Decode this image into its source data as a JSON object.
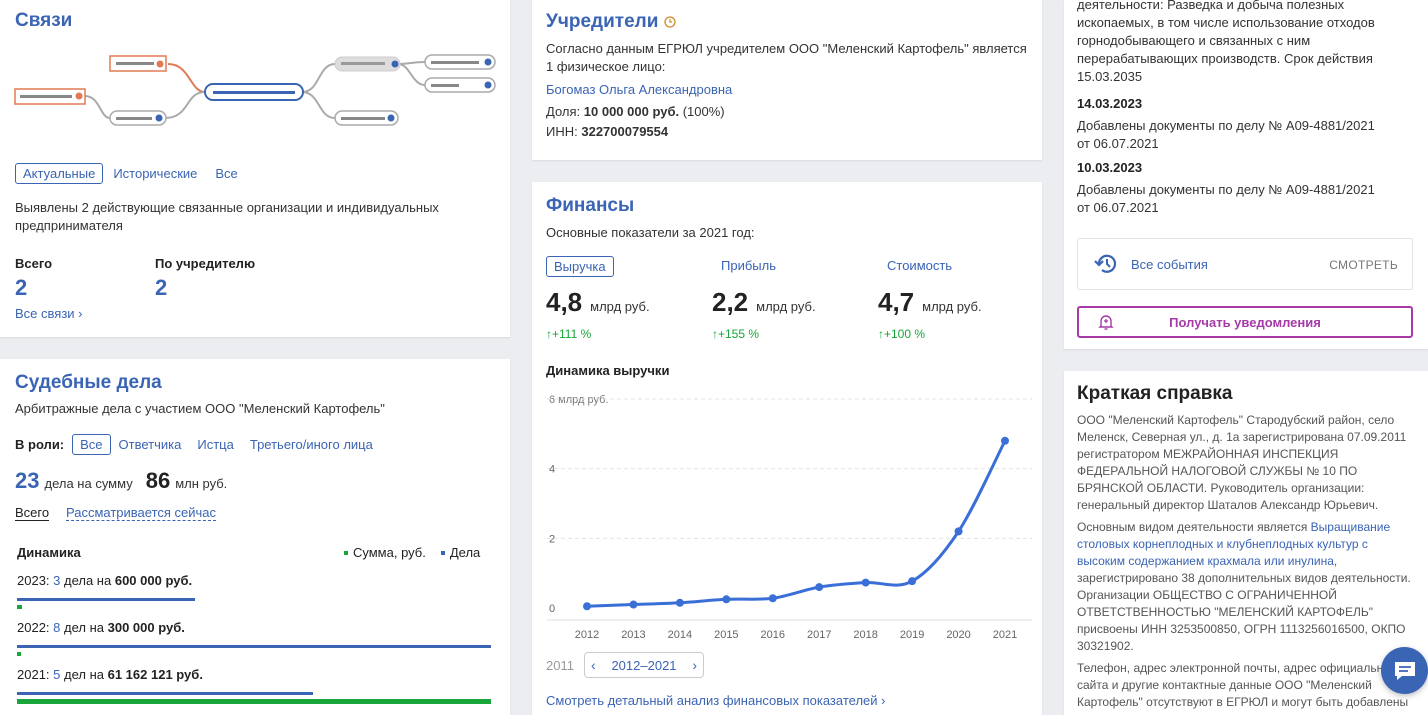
{
  "svyazi": {
    "title": "Связи",
    "tabs": [
      "Актуальные",
      "Исторические",
      "Все"
    ],
    "desc": "Выявлены 2 действующие связанные организации и индивидуальных предпринимателя",
    "total_label": "Всего",
    "total_value": "2",
    "founder_label": "По учредителю",
    "founder_value": "2",
    "all_link": "Все связи ›"
  },
  "sudebnye": {
    "title": "Судебные дела",
    "subtitle": "Арбитражные дела с участием ООО \"Меленский Картофель\"",
    "role_label": "В роли:",
    "roles": [
      "Все",
      "Ответчика",
      "Истца",
      "Третьего/иного лица"
    ],
    "count": "23",
    "count_text": "дела на сумму",
    "sum": "86",
    "sum_unit": "млн руб.",
    "filter_all": "Всего",
    "filter_current": "Рассматривается сейчас",
    "dynamics_label": "Динамика",
    "legend_sum": "Сумма, руб.",
    "legend_cases": "Дела",
    "years": [
      {
        "year": "2023:",
        "count": "3",
        "count_text": "дела на",
        "amount": "600 000 руб.",
        "cases_fraction": 0.375,
        "sum_fraction": 0.01
      },
      {
        "year": "2022:",
        "count": "8",
        "count_text": "дел на",
        "amount": "300 000 руб.",
        "cases_fraction": 1.0,
        "sum_fraction": 0.005
      },
      {
        "year": "2021:",
        "count": "5",
        "count_text": "дел на",
        "amount": "61 162 121 руб.",
        "cases_fraction": 0.625,
        "sum_fraction": 1.0
      }
    ]
  },
  "uchrediteli": {
    "title": "Учредители",
    "text": "Согласно данным ЕГРЮЛ учредителем ООО \"Меленский Картофель\" является 1 физическое лицо:",
    "person": "Богомаз Ольга Александровна",
    "share_label": "Доля:",
    "share_value": "10 000 000 руб.",
    "share_percent": "(100%)",
    "inn_label": "ИНН:",
    "inn_value": "322700079554"
  },
  "finansy": {
    "title": "Финансы",
    "subtitle": "Основные показатели за 2021 год:",
    "metrics": [
      {
        "label": "Выручка",
        "value": "4,8",
        "unit": "млрд руб.",
        "change": "↑+111 %"
      },
      {
        "label": "Прибыль",
        "value": "2,2",
        "unit": "млрд руб.",
        "change": "↑+155 %"
      },
      {
        "label": "Стоимость",
        "value": "4,7",
        "unit": "млрд руб.",
        "change": "↑+100 %"
      }
    ],
    "chart_title": "Динамика выручки",
    "y_unit_label": "6 млрд руб.",
    "y_ticks": [
      "4",
      "2",
      "0"
    ],
    "range_prev": "2011",
    "range_label": "2012–2021",
    "detail_link": "Смотреть детальный анализ финансовых показателей ›"
  },
  "chart_data": {
    "type": "line",
    "title": "Динамика выручки",
    "ylabel": "млрд руб.",
    "x": [
      "2012",
      "2013",
      "2014",
      "2015",
      "2016",
      "2017",
      "2018",
      "2019",
      "2020",
      "2021"
    ],
    "series": [
      {
        "values": [
          0.05,
          0.1,
          0.15,
          0.25,
          0.28,
          0.6,
          0.73,
          0.77,
          2.2,
          4.8
        ]
      }
    ],
    "ylim": [
      0,
      6
    ],
    "grid": true,
    "color": "#3a6fd8"
  },
  "events": {
    "top_text": "деятельности: Разведка и добыча полезных ископаемых, в том числе использование отходов горнодобывающего и связанных с ним перерабатывающих производств. Срок действия 15.03.2035",
    "items": [
      {
        "date": "14.03.2023",
        "text": "Добавлены документы по делу № А09-4881/2021 от 06.07.2021"
      },
      {
        "date": "10.03.2023",
        "text": "Добавлены документы по делу № А09-4881/2021 от 06.07.2021"
      }
    ],
    "all_events": "Все события",
    "view": "СМОТРЕТЬ",
    "notify": "Получать уведомления"
  },
  "spravka": {
    "title": "Краткая справка",
    "p1": "ООО \"Меленский Картофель\" Стародубский район, село Меленск, Северная ул., д. 1а зарегистрирована 07.09.2011 регистратором МЕЖРАЙОННАЯ ИНСПЕКЦИЯ ФЕДЕРАЛЬНОЙ НАЛОГОВОЙ СЛУЖБЫ № 10 ПО БРЯНСКОЙ ОБЛАСТИ. Руководитель организации: генеральный директор Шаталов Александр Юрьевич.",
    "p2_pre": "Основным видом деятельности является ",
    "p2_link": "Выращивание столовых корнеплодных и клубнеплодных культур с высоким содержанием крахмала или инулина",
    "p2_post": ", зарегистрировано 38 дополнительных видов деятельности. Организации ОБЩЕСТВО С ОГРАНИЧЕННОЙ ОТВЕТСТВЕННОСТЬЮ \"МЕЛЕНСКИЙ КАРТОФЕЛЬ\" присвоены ИНН 3253500850, ОГРН 1113256016500, ОКПО 30321902.",
    "p3": "Телефон, адрес электронной почты, адрес официального сайта и другие контактные данные ООО \"Меленский Картофель\" отсутствуют в ЕГРЮЛ и могут быть добавлены"
  },
  "colors": {
    "accent": "#3a64b4",
    "green": "#18a53a",
    "orange": "#e07a52",
    "purple": "#a63aa8"
  }
}
